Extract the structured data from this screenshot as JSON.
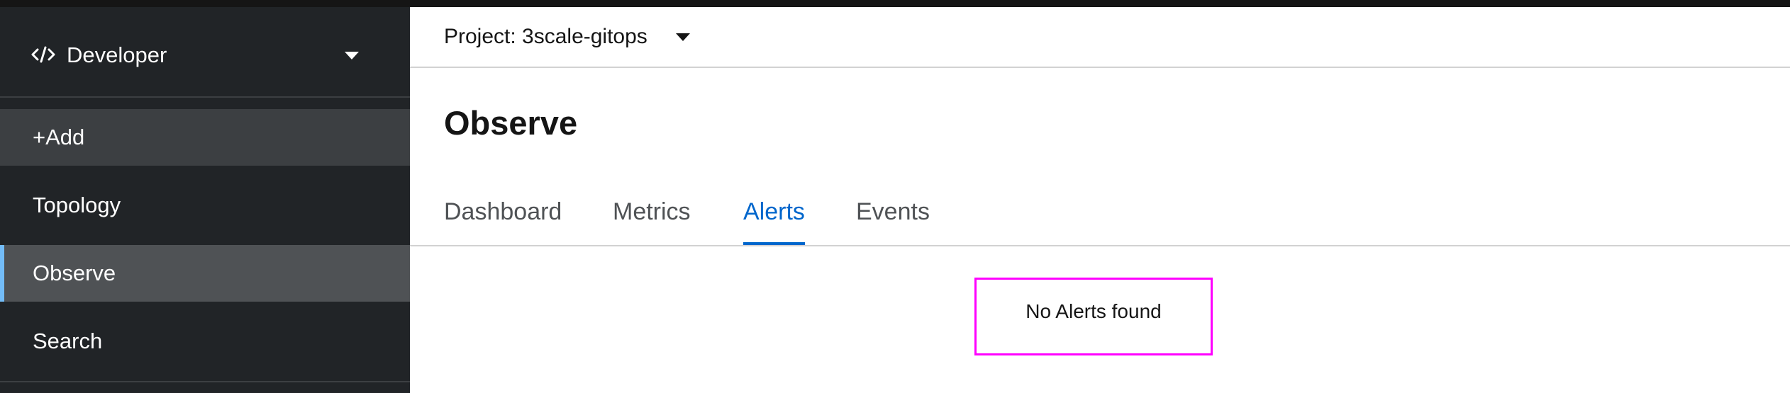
{
  "sidebar": {
    "perspective": {
      "label": "Developer",
      "icon": "code-icon"
    },
    "items": [
      {
        "label": "+Add",
        "state": "hover"
      },
      {
        "label": "Topology",
        "state": "normal"
      },
      {
        "label": "Observe",
        "state": "active"
      },
      {
        "label": "Search",
        "state": "normal"
      }
    ],
    "active_accent_color": "#73bcf7"
  },
  "project_bar": {
    "label": "Project: 3scale-gitops"
  },
  "page": {
    "title": "Observe"
  },
  "tabs": [
    {
      "label": "Dashboard",
      "active": false
    },
    {
      "label": "Metrics",
      "active": false
    },
    {
      "label": "Alerts",
      "active": true
    },
    {
      "label": "Events",
      "active": false
    }
  ],
  "content": {
    "empty_message": "No Alerts found",
    "highlight_color": "#ff00ff"
  },
  "colors": {
    "sidebar_bg": "#212427",
    "accent": "#0066cc"
  }
}
